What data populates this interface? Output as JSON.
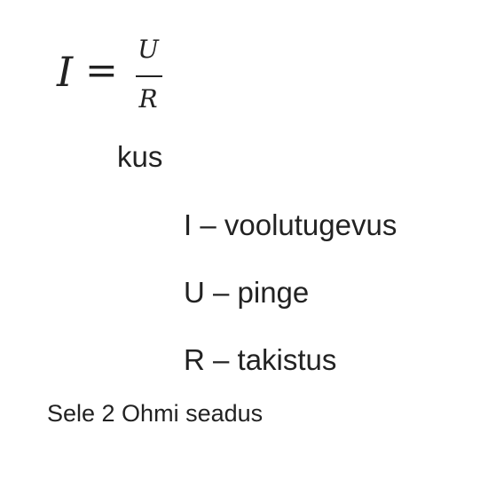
{
  "formula": {
    "lhs": "I",
    "equals": "=",
    "numerator": "U",
    "denominator": "R"
  },
  "intro": "kus",
  "definitions": [
    "I – voolutugevus",
    "U – pinge",
    "R – takistus"
  ],
  "caption": "Sele 2 Ohmi seadus"
}
